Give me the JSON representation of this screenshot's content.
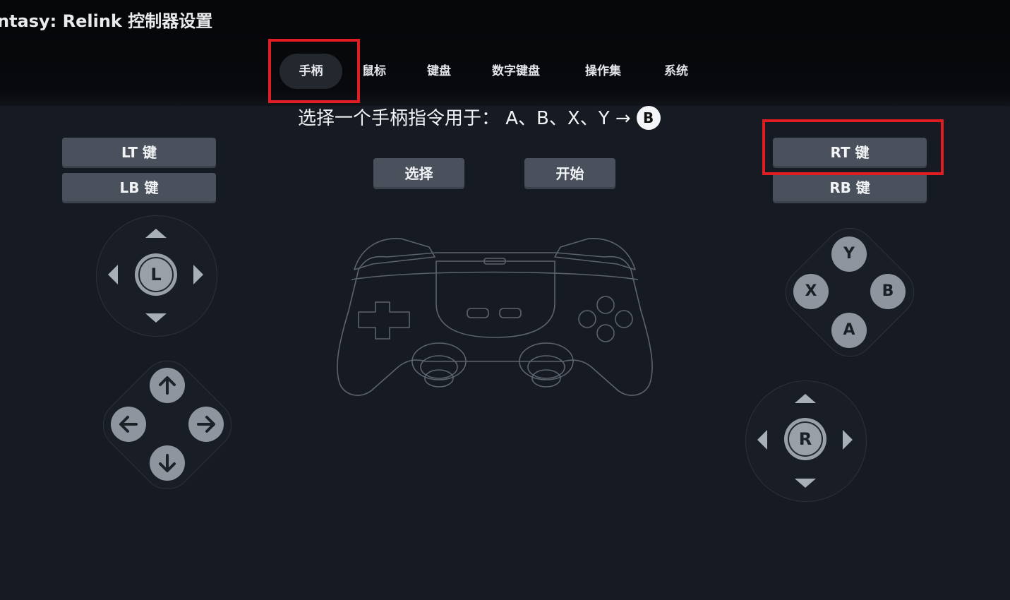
{
  "window": {
    "title": "ntasy: Relink 控制器设置"
  },
  "tabs": [
    {
      "label": "手柄",
      "active": true
    },
    {
      "label": "鼠标",
      "active": false
    },
    {
      "label": "键盘",
      "active": false
    },
    {
      "label": "数字键盘",
      "active": false
    },
    {
      "label": "操作集",
      "active": false
    },
    {
      "label": "系统",
      "active": false
    }
  ],
  "instruction": {
    "text": "选择一个手柄指令用于：  A、B、X、Y →",
    "badge": "B"
  },
  "left_panel": {
    "lt_label": "LT 键",
    "lb_label": "LB 键",
    "stick_label": "L"
  },
  "center": {
    "select_label": "选择",
    "start_label": "开始"
  },
  "right_panel": {
    "rt_label": "RT 键",
    "rb_label": "RB 键",
    "face_buttons": {
      "y": "Y",
      "x": "X",
      "b": "B",
      "a": "A"
    },
    "stick_label": "R"
  },
  "colors": {
    "background": "#161a22",
    "button": "#4a515c",
    "highlight": "#e11d24"
  }
}
